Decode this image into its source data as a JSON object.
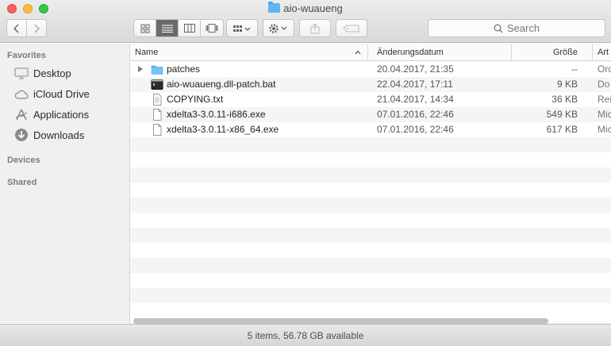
{
  "window": {
    "title": "aio-wuaueng"
  },
  "toolbar": {
    "search_placeholder": "Search"
  },
  "sidebar": {
    "sections": [
      {
        "label": "Favorites"
      },
      {
        "label": "Devices"
      },
      {
        "label": "Shared"
      }
    ],
    "items": [
      {
        "label": "Desktop",
        "icon": "desktop-icon"
      },
      {
        "label": "iCloud Drive",
        "icon": "cloud-icon"
      },
      {
        "label": "Applications",
        "icon": "applications-icon"
      },
      {
        "label": "Downloads",
        "icon": "downloads-icon"
      }
    ]
  },
  "columns": {
    "name": "Name",
    "date": "Änderungsdatum",
    "size": "Größe",
    "kind": "Art"
  },
  "files": [
    {
      "name": "patches",
      "date": "20.04.2017, 21:35",
      "size": "--",
      "kind": "Ord",
      "icon": "folder-icon"
    },
    {
      "name": "aio-wuaueng.dll-patch.bat",
      "date": "22.04.2017, 17:11",
      "size": "9 KB",
      "kind": "Do",
      "icon": "terminal-file-icon"
    },
    {
      "name": "COPYING.txt",
      "date": "21.04.2017, 14:34",
      "size": "36 KB",
      "kind": "Rei",
      "icon": "text-file-icon"
    },
    {
      "name": "xdelta3-3.0.11-i686.exe",
      "date": "07.01.2016, 22:46",
      "size": "549 KB",
      "kind": "Mic",
      "icon": "document-icon"
    },
    {
      "name": "xdelta3-3.0.11-x86_64.exe",
      "date": "07.01.2016, 22:46",
      "size": "617 KB",
      "kind": "Mic",
      "icon": "document-icon"
    }
  ],
  "status": {
    "text": "5 items, 56.78 GB available"
  },
  "colors": {
    "folder": "#5fb6f2",
    "close": "#fc605c",
    "minimize": "#fdbc40",
    "maximize": "#34c84a"
  }
}
